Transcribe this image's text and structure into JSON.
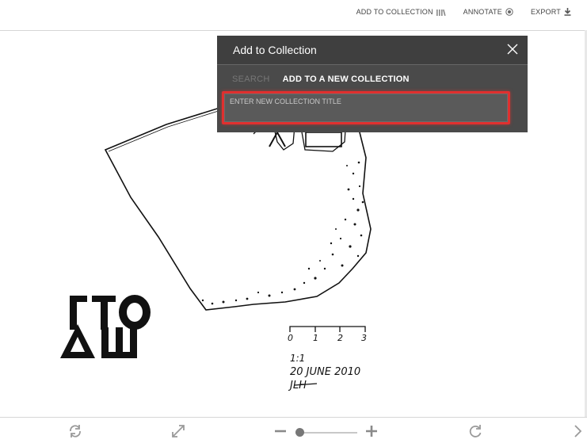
{
  "toolbar": {
    "add_to_collection": "ADD TO COLLECTION",
    "annotate": "ANNOTATE",
    "export": "EXPORT"
  },
  "dialog": {
    "title": "Add to Collection",
    "tab_search": "SEARCH",
    "tab_new": "ADD TO A NEW COLLECTION",
    "input_placeholder": "ENTER NEW COLLECTION TITLE",
    "input_value": ""
  },
  "drawing": {
    "scale_ticks": [
      "0",
      "1",
      "2",
      "3"
    ],
    "ratio": "1:1",
    "date": "20 JUNE 2010",
    "initials": "JLH",
    "inscription": "ΓΤΟ ΔШ"
  },
  "colors": {
    "dialog_bg": "#4a4a4a",
    "highlight": "#e0302f",
    "toolbar_text": "#444444"
  }
}
